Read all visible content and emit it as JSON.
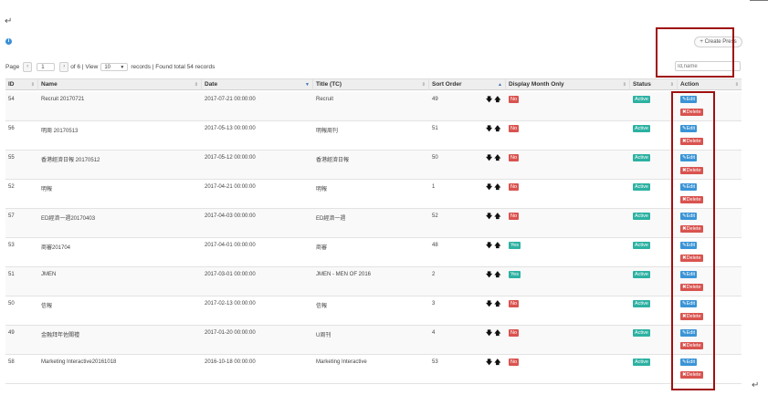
{
  "markers": {
    "return_glyph": "↵"
  },
  "info_icon_glyph": "i",
  "pager": {
    "page_label": "Page",
    "prev_glyph": "‹",
    "current_page": "1",
    "next_glyph": "›",
    "of_pages_text": "of 6 | View",
    "view_count": "10",
    "select_caret": "▼",
    "records_text": "records | Found total 54 records"
  },
  "toolbar": {
    "create_label": "+ Create Press",
    "search_placeholder": "Id,name"
  },
  "table": {
    "sort_glyphs": {
      "none": "⇕",
      "asc": "▲",
      "desc": "▼"
    },
    "columns": [
      {
        "label": "ID",
        "sort": "none"
      },
      {
        "label": "Name",
        "sort": "none"
      },
      {
        "label": "Date",
        "sort": "desc"
      },
      {
        "label": "Title (TC)",
        "sort": "none"
      },
      {
        "label": "Sort Order",
        "sort": "asc"
      },
      {
        "label": "Display Month Only",
        "sort": "none"
      },
      {
        "label": "Status",
        "sort": "none"
      },
      {
        "label": "Action",
        "sort": "none"
      }
    ],
    "row_arrows": "🡇🡅",
    "edit_label": "✎Edit",
    "delete_label": "✖Delete",
    "rows": [
      {
        "id": "54",
        "name": "Recruit 20170721",
        "date": "2017-07-21 00:00:00",
        "title_tc": "Recruit",
        "sort_order": "49",
        "display_month_only": "No",
        "status": "Active"
      },
      {
        "id": "56",
        "name": "明周 20170513",
        "date": "2017-05-13 00:00:00",
        "title_tc": "明報周刊",
        "sort_order": "51",
        "display_month_only": "No",
        "status": "Active"
      },
      {
        "id": "55",
        "name": "香港經濟日報 20170512",
        "date": "2017-05-12 00:00:00",
        "title_tc": "香港經濟日報",
        "sort_order": "50",
        "display_month_only": "No",
        "status": "Active"
      },
      {
        "id": "52",
        "name": "明報",
        "date": "2017-04-21 00:00:00",
        "title_tc": "明報",
        "sort_order": "1",
        "display_month_only": "No",
        "status": "Active"
      },
      {
        "id": "57",
        "name": "ED經濟一週20170403",
        "date": "2017-04-03 00:00:00",
        "title_tc": "ED經濟一週",
        "sort_order": "52",
        "display_month_only": "No",
        "status": "Active"
      },
      {
        "id": "53",
        "name": "商審201704",
        "date": "2017-04-01 00:00:00",
        "title_tc": "商審",
        "sort_order": "48",
        "display_month_only": "Yes",
        "status": "Active"
      },
      {
        "id": "51",
        "name": "JMEN",
        "date": "2017-03-01 00:00:00",
        "title_tc": "JMEN - MEN OF 2016",
        "sort_order": "2",
        "display_month_only": "Yes",
        "status": "Active"
      },
      {
        "id": "50",
        "name": "信報",
        "date": "2017-02-13 00:00:00",
        "title_tc": "信報",
        "sort_order": "3",
        "display_month_only": "No",
        "status": "Active"
      },
      {
        "id": "49",
        "name": "金融拜年佐關禮",
        "date": "2017-01-20 00:00:00",
        "title_tc": "U周刊",
        "sort_order": "4",
        "display_month_only": "No",
        "status": "Active"
      },
      {
        "id": "58",
        "name": "Marketing Interactive20161018",
        "date": "2016-10-18 00:00:00",
        "title_tc": "Marketing Interactive",
        "sort_order": "53",
        "display_month_only": "No",
        "status": "Active"
      }
    ]
  },
  "colors": {
    "highlight": "#a01010",
    "edit": "#3a94d6",
    "delete": "#d9534f",
    "active": "#2db1a2",
    "no": "#d9534f",
    "yes": "#2db1a2"
  }
}
